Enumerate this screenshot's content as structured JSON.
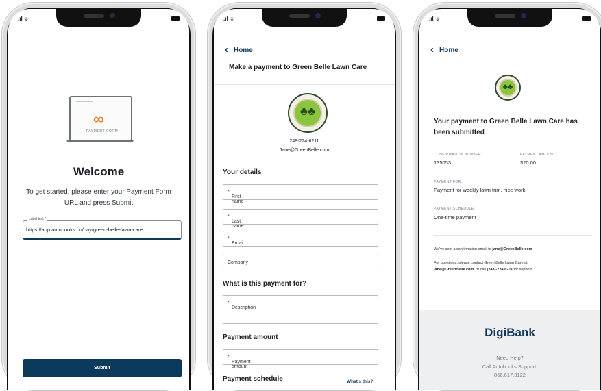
{
  "phone1": {
    "form_logo_text": "PAYMENT FORM",
    "title": "Welcome",
    "intro": "To get started, please enter your Payment Form URL and press Submit",
    "url_label": "Label text *",
    "url_value": "https://app.autobooks.co/pay/green-belle-lawn-care",
    "submit_label": "Submit"
  },
  "phone2": {
    "back_label": "Home",
    "header": "Make a payment to Green Belle Lawn Care",
    "phone": "248-224-6211",
    "email": "Jane@GreenBelle.com",
    "your_details": "Your details",
    "first_name": "First name",
    "last_name": "Last name",
    "email_field": "Email",
    "company": "Company",
    "what_for": "What is this payment for?",
    "description": "Description",
    "payment_amount_heading": "Payment amount",
    "payment_amount_field": "Payment amount",
    "payment_schedule": "Payment schedule",
    "whats_this": "What's this?",
    "required_mark": "*"
  },
  "phone3": {
    "back_label": "Home",
    "title": "Your payment to Green Belle Lawn Care has been submitted",
    "confirmation_caption": "CONFIRMATION NUMBER:",
    "confirmation_number": "135053",
    "amount_caption": "PAYMENT AMOUNT:",
    "amount": "$20.00",
    "payment_for_caption": "PAYMENT FOR:",
    "payment_for": "Payment for weekly lawn trim, nice work!",
    "schedule_caption": "PAYMENT SCHEDULE:",
    "schedule": "One-time payment",
    "sent_prefix": "We've sent a confirmation email to ",
    "sent_email": "jane@GreenBelle.com",
    "questions_prefix": "For questions, please contact Green Belle Lawn Care at",
    "questions_email": "jane@GreenBelle.com",
    "questions_mid": ", or call ",
    "questions_phone": "(248)-224-6211",
    "questions_suffix": " for support",
    "bank_name": "DigiBank",
    "help_line1": "Need Help?",
    "help_line2": "Call Autobooks Support:",
    "help_line3": "866.617.3122"
  },
  "colors": {
    "navy": "#0c3a5b",
    "accent_orange": "#f37321",
    "required_red": "#d0021b"
  },
  "icons": [
    "signal-icon",
    "wifi-icon",
    "battery-icon",
    "chevron-left-icon",
    "green-belle-logo",
    "infinity-logo"
  ]
}
